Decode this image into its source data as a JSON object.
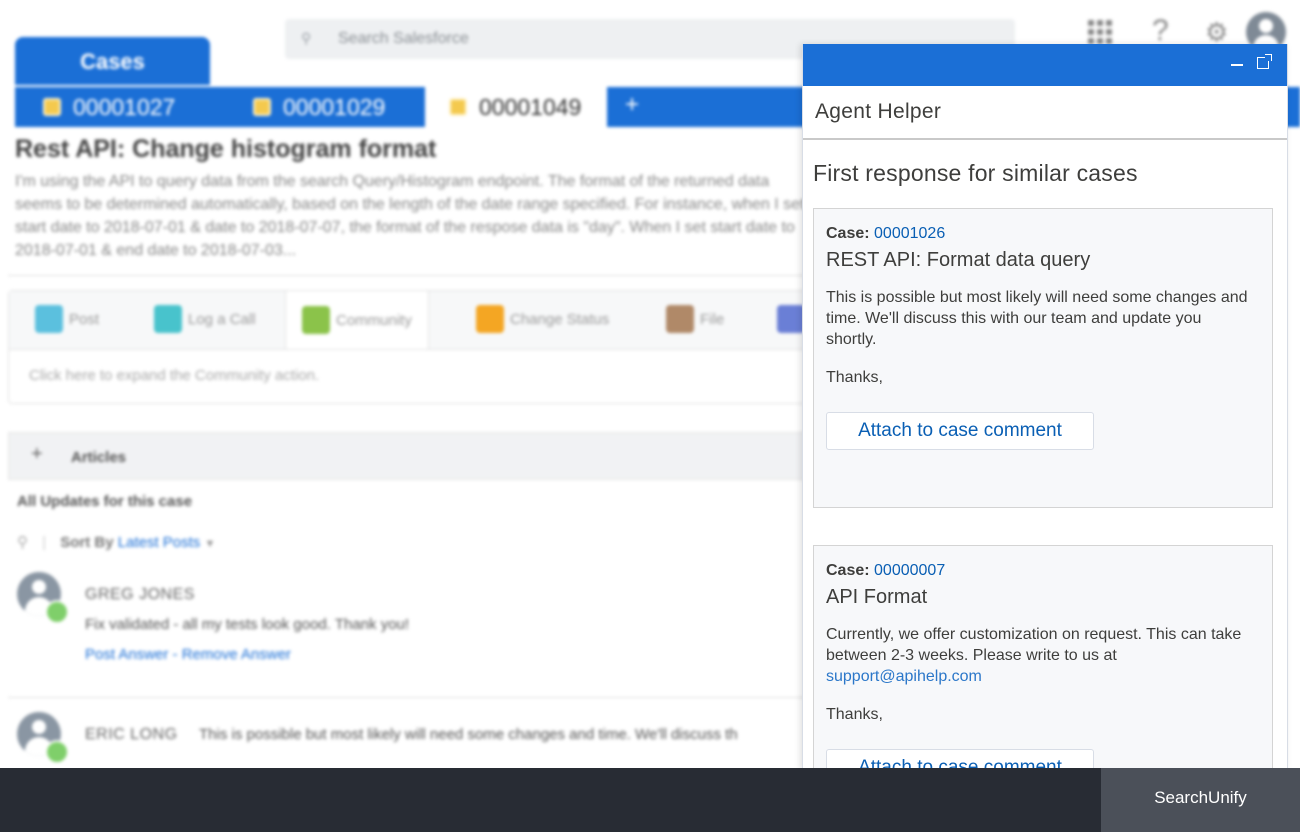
{
  "header": {
    "search_placeholder": "Search Salesforce"
  },
  "app_tab": {
    "label": "Cases"
  },
  "subtabs": [
    {
      "label": "00001027"
    },
    {
      "label": "00001029"
    },
    {
      "label": "00001049"
    }
  ],
  "subtab_add": "+",
  "case": {
    "title": "Rest API: Change histogram format",
    "description": "I'm using the API to query data from the search Query/Histogram endpoint. The format of the returned data seems to be determined automatically, based on the length of the date range specified. For instance, when I set start date to 2018-07-01 & date to 2018-07-07, the format of the respose data is \"day\". When I set start date to 2018-07-01 & end date to 2018-07-03..."
  },
  "actions": {
    "items": [
      {
        "label": "Post",
        "color": "#5bc0de"
      },
      {
        "label": "Log a Call",
        "color": "#48c3cc"
      },
      {
        "label": "Community",
        "color": "#8bc34a"
      },
      {
        "label": "Change Status",
        "color": "#f4a623"
      },
      {
        "label": "File",
        "color": "#b08968"
      }
    ],
    "expand_text": "Click here to expand the Community action."
  },
  "articles": {
    "plus": "+",
    "label": "Articles"
  },
  "feed": {
    "updates_label": "All Updates for this case",
    "sort_prefix": "Sort By",
    "sort_value": "Latest Posts",
    "items": [
      {
        "name": "GREG JONES",
        "text": "Fix validated - all my tests look good. Thank you!",
        "links": "Post Answer - Remove Answer"
      },
      {
        "name": "ERIC LONG",
        "text": "This is possible but most likely will need some changes and time. We'll discuss th"
      }
    ]
  },
  "panel": {
    "title": "Agent Helper",
    "section_title": "First response for similar cases",
    "cards": [
      {
        "case_prefix": "Case:",
        "case_number": "00001026",
        "title": "REST API: Format data query",
        "body": "This is possible but most likely will need some changes and time. We'll discuss this with our team and update you shortly.",
        "thanks": "Thanks,",
        "button": "Attach to case comment"
      },
      {
        "case_prefix": "Case:",
        "case_number": "00000007",
        "title": "API Format",
        "body": "Currently, we offer customization on request. This can take between 2-3 weeks. Please write to us at",
        "email": "support@apihelp.com",
        "thanks": "Thanks,",
        "button": "Attach to case comment"
      }
    ]
  },
  "footer": {
    "button": "SearchUnify"
  },
  "colors": {
    "brand_blue": "#1b6fd6",
    "link_blue": "#0a5fb4",
    "footer_dark": "#282c34",
    "footer_button": "#4b5059"
  }
}
